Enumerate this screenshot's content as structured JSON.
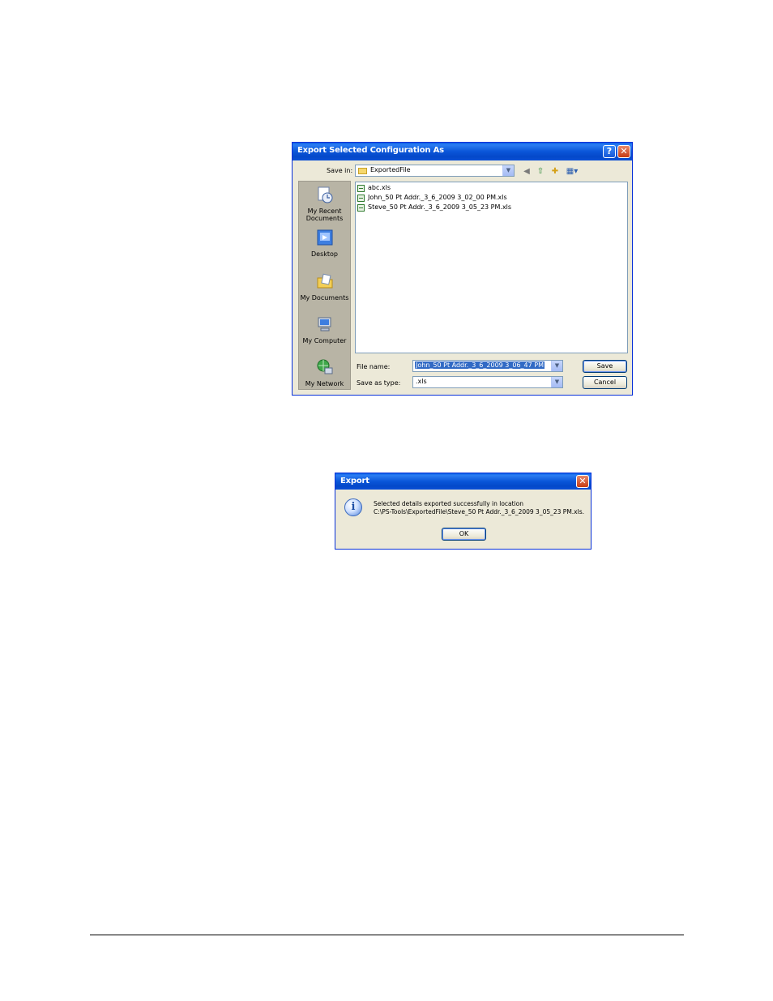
{
  "save_dialog": {
    "title": "Export Selected Configuration As",
    "help_button": "?",
    "close_button": "✕",
    "save_in_label": "Save in:",
    "save_in_value": "ExportedFile",
    "places": [
      {
        "label": "My Recent Documents"
      },
      {
        "label": "Desktop"
      },
      {
        "label": "My Documents"
      },
      {
        "label": "My Computer"
      },
      {
        "label": "My Network"
      }
    ],
    "files": [
      "abc.xls",
      "John_50 Pt Addr._3_6_2009 3_02_00 PM.xls",
      "Steve_50 Pt Addr._3_6_2009 3_05_23 PM.xls"
    ],
    "file_name_label": "File name:",
    "file_name_value": "John_50 Pt Addr._3_6_2009 3_06_47 PM",
    "save_as_type_label": "Save as type:",
    "save_as_type_value": ".xls",
    "save_button": "Save",
    "cancel_button": "Cancel"
  },
  "export_dialog": {
    "title": "Export",
    "close_button": "✕",
    "info_icon": "i",
    "message_line1": "Selected details exported successfully in location",
    "message_line2": "C:\\PS-Tools\\ExportedFile\\Steve_50 Pt Addr._3_6_2009 3_05_23 PM.xls.",
    "ok_button": "OK"
  },
  "colors": {
    "title_bar": "#0a55d8",
    "dialog_bg": "#ece9d8",
    "places_bar": "#b8b4a5",
    "selection": "#316ac5"
  }
}
